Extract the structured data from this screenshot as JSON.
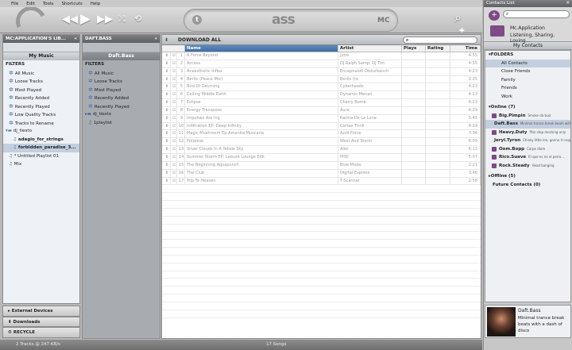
{
  "menu": [
    "File",
    "Edit",
    "Tools",
    "Shortcuts",
    "Help"
  ],
  "player": {
    "brand": "ass",
    "mc": "MC",
    "twitter": "t"
  },
  "library": {
    "path": "MC:APPLICATION'S LIB...",
    "section": "My Music",
    "filters_label": "FILTERS",
    "filters": [
      "All Music",
      "Loose Tracks",
      "Most Played",
      "Recently Added",
      "Recently Played",
      "Low Quality Tracks",
      "Tracks to Rename"
    ],
    "folder": "dj_tiesto",
    "tracks": [
      "adagio_for_strings",
      "forbidden_paradise_3..."
    ],
    "playlists": [
      "* Untitled Playlist 01",
      "Mix"
    ]
  },
  "friendlib": {
    "path": "DAFT.BASS",
    "section": "Daft.Bass",
    "filters_label": "FILTERS",
    "filters": [
      "All Music",
      "Loose Tracks",
      "Most Played",
      "Recently Added",
      "Recently Played"
    ],
    "folder": "dj_tiesto",
    "playlist": "1playlist"
  },
  "bottomnav": [
    "External Devices",
    "Downloads",
    "RECYCLE"
  ],
  "status": {
    "left": "2 Tracks @ 247 KB/s",
    "center": "17 Songs"
  },
  "main": {
    "download": "DOWNLOAD ALL",
    "search_placeholder": "",
    "columns": [
      "Name",
      "Artist",
      "Plays",
      "Rating",
      "Time"
    ],
    "rows": [
      [
        "1",
        "A Force Beyond",
        "Juno",
        "4:55"
      ],
      [
        "2",
        "Access",
        "DJ Ralph Samp; Dj Tim",
        "4:55"
      ],
      [
        "3",
        "Aneesthetic Inflex",
        "Encephalotl Disturbanch",
        "4:23"
      ],
      [
        "4",
        "Berlin (Peace Mix)",
        "Berlin Inc",
        "2:25"
      ],
      [
        "5",
        "Bird Of Devrning",
        "Cyberheads",
        "4:23"
      ],
      [
        "6",
        "Ceiling Middle Earth",
        "Dynamic Menan",
        "4:13"
      ],
      [
        "7",
        "Eclipse",
        "Cherry Bomb",
        "6:23"
      ],
      [
        "8",
        "Energy Transpose",
        "Aura",
        "4:29"
      ],
      [
        "9",
        "Impulses Are Ing",
        "Karma De La Luna",
        "5:45"
      ],
      [
        "10",
        "Infiltration EP: Deep Infinity",
        "Cortex Thrill",
        "4:19"
      ],
      [
        "11",
        "Magic Mushroom Ep-Amanita Muscaria",
        "Azzil Force",
        "7:36"
      ],
      [
        "12",
        "Porpoise",
        "West And Storm",
        "6:09"
      ],
      [
        "13",
        "Silver Clouds In A Yellow Sky",
        "Alec",
        "6:13"
      ],
      [
        "14",
        "Summer Storm EP: Leisure Lounge Edit",
        "PHD",
        "5:07"
      ],
      [
        "15",
        "The Beginning Aquapunch",
        "Blue Moda",
        "2:21"
      ],
      [
        "16",
        "The Club",
        "Digital Express",
        "3:46"
      ],
      [
        "17",
        "Trip To Heaven",
        "T-Scanner",
        "2:58"
      ]
    ]
  },
  "contacts": {
    "title": "Contacts List",
    "profile_name": "Mc.Application",
    "profile_status": "Listening, Sharing, Loving...",
    "header": "My Contacts",
    "folders_label": "FOLDERS",
    "folders": [
      "All Contacts",
      "Close Friends",
      "Family",
      "Friends",
      "Work"
    ],
    "online_label": "Online (7)",
    "online": [
      [
        "Big.Pimpin",
        "Smoke da bud"
      ],
      [
        "Daft.Bass",
        "Minimal trance break beats with"
      ],
      [
        "Heavy.Duty",
        "Plzz stop mocking only"
      ],
      [
        "Jeryl.Tyron",
        "Chinky little leo, gonna it range"
      ],
      [
        "Oom.Bopp",
        "Carpe diem"
      ],
      [
        "Rico.Suave",
        "El que es no el perro..."
      ],
      [
        "Rock.Steady",
        "Head banging"
      ]
    ],
    "offline_label": "Offline (5)",
    "future_label": "Future Contacts (0)",
    "nowplaying": {
      "name": "Daft.Bass",
      "text": "Minimal trance break beats with a dash of disco"
    }
  },
  "colors": {
    "accent": "#7b4a86",
    "selected": "#3f6ea5"
  }
}
